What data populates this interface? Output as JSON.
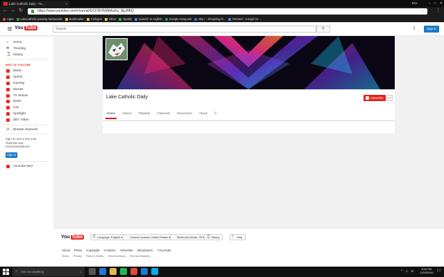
{
  "browser": {
    "tab_title": "Lake Catholic Daily - Yo...",
    "tab_close": "×",
    "user_badge": "Eric",
    "window_controls": [
      "–",
      "□",
      "✕"
    ],
    "url": "https://www.youtube.com/channel/UCF3hYkMb4sxhz_8jyJMtQ",
    "bookmarks": [
      {
        "label": "Apps",
        "color": "#d44"
      },
      {
        "label": "Lakecatholic passing backwards",
        "color": "#2a9d3c"
      },
      {
        "label": "Bookmarks",
        "color": "#e8c34a"
      },
      {
        "label": "Colleges",
        "color": "#e8c34a"
      },
      {
        "label": "Other",
        "color": "#e8c34a"
      },
      {
        "label": "Spotify",
        "color": "#1db954"
      },
      {
        "label": "spanish to english",
        "color": "#4285f4"
      },
      {
        "label": "Google Hangouts",
        "color": "#0f9d58"
      },
      {
        "label": "Sky+ - Shopping M...",
        "color": "#1a73e8"
      },
      {
        "label": "Richard - Google Dr...",
        "color": "#4285f4"
      }
    ]
  },
  "youtube": {
    "logo_you": "You",
    "logo_tube": "Tube",
    "search_placeholder": "Search",
    "search_icon": "⚲",
    "upload_icon": "⇪",
    "signin_label": "Sign in",
    "sidebar": {
      "main": [
        {
          "label": "Home",
          "icon": "home-icon"
        },
        {
          "label": "Trending",
          "icon": "trending-icon"
        },
        {
          "label": "History",
          "icon": "history-icon"
        }
      ],
      "best_heading": "BEST OF YOUTUBE",
      "best": [
        {
          "label": "Music",
          "color": "#e52d27"
        },
        {
          "label": "Sports",
          "color": "#e52d27"
        },
        {
          "label": "Gaming",
          "color": "#e52d27"
        },
        {
          "label": "Movies",
          "color": "#e52d27"
        },
        {
          "label": "TV Shows",
          "color": "#e52d27"
        },
        {
          "label": "News",
          "color": "#e52d27"
        },
        {
          "label": "Live",
          "color": "#e52d27"
        },
        {
          "label": "Spotlight",
          "color": "#e52d27"
        },
        {
          "label": "360° Video",
          "color": "#e52d27"
        }
      ],
      "browse_channels": "Browse channels",
      "signin_note": "Sign in now to see your channels and recommendations!",
      "signin_button": "Sign in",
      "youtube_red": "YouTube Red"
    },
    "channel": {
      "name": "Lake Catholic Daily",
      "subscribe_label": "Subscribe",
      "subscriber_count": "17",
      "tabs": [
        "Home",
        "Videos",
        "Playlists",
        "Channels",
        "Discussion",
        "About"
      ],
      "active_tab": "Home"
    },
    "footer": {
      "language": "Language: English",
      "location": "Content location: United States",
      "restricted": "Restricted Mode: Off",
      "history": "History",
      "help": "Help",
      "links_primary": [
        "About",
        "Press",
        "Copyright",
        "Creators",
        "Advertise",
        "Developers",
        "+YouTube"
      ],
      "links_secondary": [
        "Terms",
        "Privacy",
        "Policy & Safety",
        "Send feedback",
        "Test new features"
      ]
    }
  },
  "taskbar": {
    "search_placeholder": "Ask me anything",
    "time": "8:24 PM",
    "date": "12/19/2016",
    "apps": [
      {
        "name": "task-view-icon",
        "color": "#555"
      },
      {
        "name": "edge-icon",
        "color": "#1e78d4"
      },
      {
        "name": "file-explorer-icon",
        "color": "#e8b84a"
      },
      {
        "name": "spotify-icon",
        "color": "#1db954"
      },
      {
        "name": "chrome-icon",
        "color": "#de4b39"
      },
      {
        "name": "store-icon",
        "color": "#1e78d4"
      },
      {
        "name": "skype-icon",
        "color": "#00aff0"
      }
    ]
  }
}
